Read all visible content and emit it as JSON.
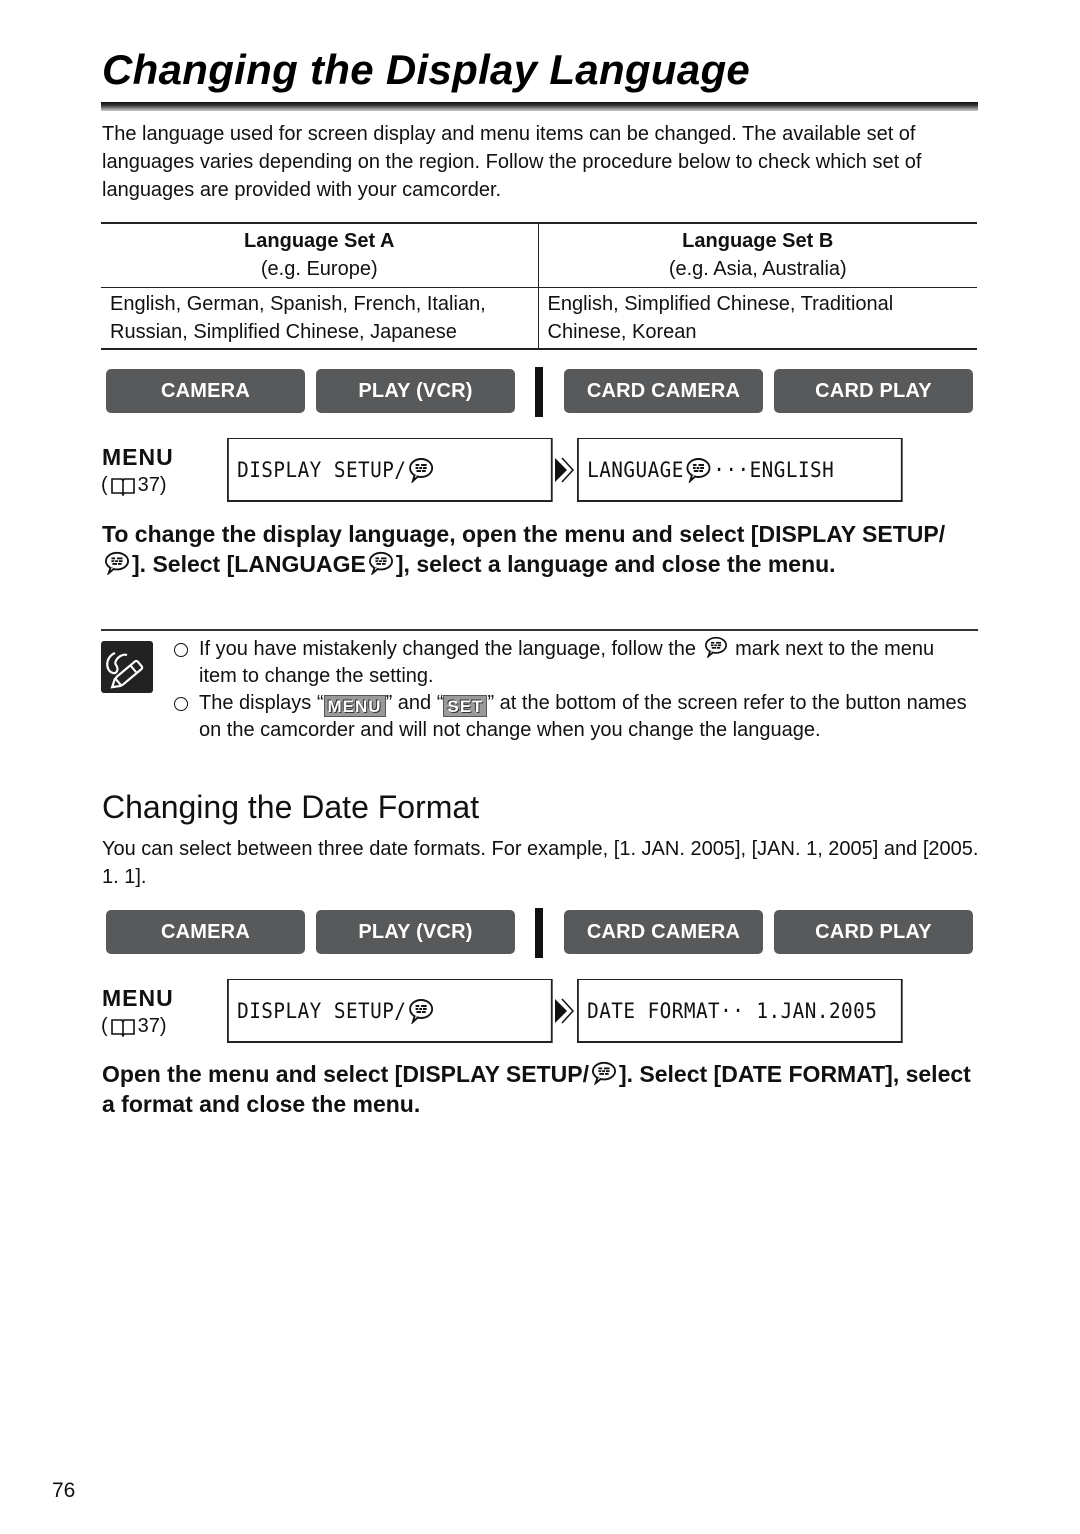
{
  "page": {
    "title": "Changing the Display Language",
    "intro": "The language used for screen display and menu items can be changed. The available set of languages varies depending on the region. Follow the procedure below to check which set of languages are provided with your camcorder.",
    "page_number": "76"
  },
  "language_table": {
    "headers": [
      {
        "title": "Language Set A",
        "subtitle": "(e.g. Europe)"
      },
      {
        "title": "Language Set B",
        "subtitle": "(e.g. Asia, Australia)"
      }
    ],
    "rows": [
      [
        "English, German, Spanish, French, Italian, Russian, Simplified Chinese, Japanese",
        "English, Simplified Chinese, Traditional Chinese, Korean"
      ]
    ]
  },
  "mode_buttons": {
    "colors": {
      "button_bg": "#58595b",
      "button_text": "#ffffff"
    },
    "items": [
      "CAMERA",
      "PLAY (VCR)",
      "CARD CAMERA",
      "CARD PLAY"
    ]
  },
  "section1": {
    "menu_label": "MENU",
    "page_ref_open": "(",
    "page_ref_num": "37)",
    "step1": "DISPLAY SETUP/",
    "step2_prefix": "LANGUAGE",
    "step2_suffix": "···ENGLISH",
    "instruction": {
      "part1": "To change the display language, open the menu and select [DISPLAY SETUP/",
      "part2": "]. Select [LANGUAGE",
      "part3": "], select a language and close the menu."
    }
  },
  "notes": {
    "icon": "pencil-note-icon",
    "items": [
      {
        "part1": "If you have mistakenly changed the language, follow the ",
        "part2": " mark next to the menu item to change the setting."
      },
      {
        "part1": "The displays “",
        "chip1": "MENU",
        "part2": "” and “",
        "chip2": "SET",
        "part3": "” at the bottom of the screen refer to the button names on the camcorder and will not change when you change the language."
      }
    ]
  },
  "section2": {
    "title": "Changing the Date Format",
    "intro": "You can select between three date formats. For example, [1. JAN. 2005], [JAN. 1, 2005] and [2005. 1. 1].",
    "menu_label": "MENU",
    "page_ref_open": "(",
    "page_ref_num": "37)",
    "step1": "DISPLAY SETUP/",
    "step2": "DATE FORMAT·· 1.JAN.2005",
    "instruction": {
      "part1": "Open the menu and select [DISPLAY SETUP/",
      "part2": "]. Select [DATE FORMAT], select a format and close the menu."
    }
  }
}
